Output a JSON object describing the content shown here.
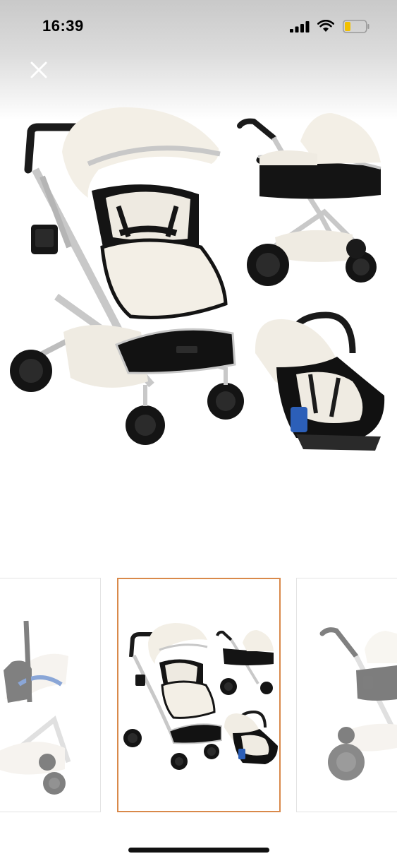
{
  "status_bar": {
    "time": "16:39"
  },
  "colors": {
    "accent_selected_border": "#d9894a",
    "cream": "#f3efe6",
    "frame_silver": "#c8c8c8",
    "black": "#121212"
  },
  "icons": {
    "close": "close-icon",
    "signal": "signal-icon",
    "wifi": "wifi-icon",
    "battery": "battery-icon"
  },
  "gallery": {
    "hero_image": "stroller-travel-system-image",
    "thumbnails": [
      {
        "name": "thumbnail-1",
        "selected": false
      },
      {
        "name": "thumbnail-2",
        "selected": true
      },
      {
        "name": "thumbnail-3",
        "selected": false
      }
    ]
  }
}
